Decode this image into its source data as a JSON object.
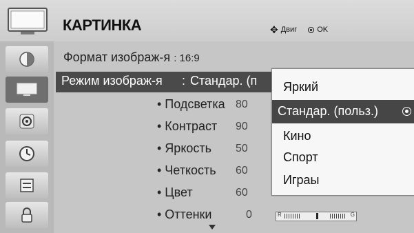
{
  "header": {
    "title": "КАРТИНКА",
    "hint_move": "Двиг",
    "hint_ok": "OK",
    "icon": "tv-icon"
  },
  "sidebar": {
    "items": [
      {
        "icon": "picture-quality-icon",
        "selected": false
      },
      {
        "icon": "tv-picture-icon",
        "selected": true
      },
      {
        "icon": "speaker-icon",
        "selected": false
      },
      {
        "icon": "clock-icon",
        "selected": false
      },
      {
        "icon": "options-icon",
        "selected": false
      },
      {
        "icon": "lock-icon",
        "selected": false
      }
    ]
  },
  "menu": {
    "aspect_label": "Формат изображ-я",
    "aspect_value": ": 16:9",
    "mode_label": "Режим изображ-я",
    "mode_value": "Стандар. (п",
    "settings": [
      {
        "label": "• Подсветка",
        "value": "80"
      },
      {
        "label": "• Контраст",
        "value": "90"
      },
      {
        "label": "• Яркость",
        "value": "50"
      },
      {
        "label": "• Четкость",
        "value": "60"
      },
      {
        "label": "• Цвет",
        "value": "60"
      },
      {
        "label": "• Оттенки",
        "value": "0"
      }
    ],
    "tint_bar": {
      "left": "R",
      "right": "G",
      "level": 0.5
    }
  },
  "dropdown": {
    "options": [
      "Яркий",
      "Стандар. (польз.)",
      "Кино",
      "Спорт",
      "Играы"
    ],
    "selected_index": 1
  },
  "colors": {
    "highlight": "#464646",
    "panel": "#c6c6c6"
  }
}
